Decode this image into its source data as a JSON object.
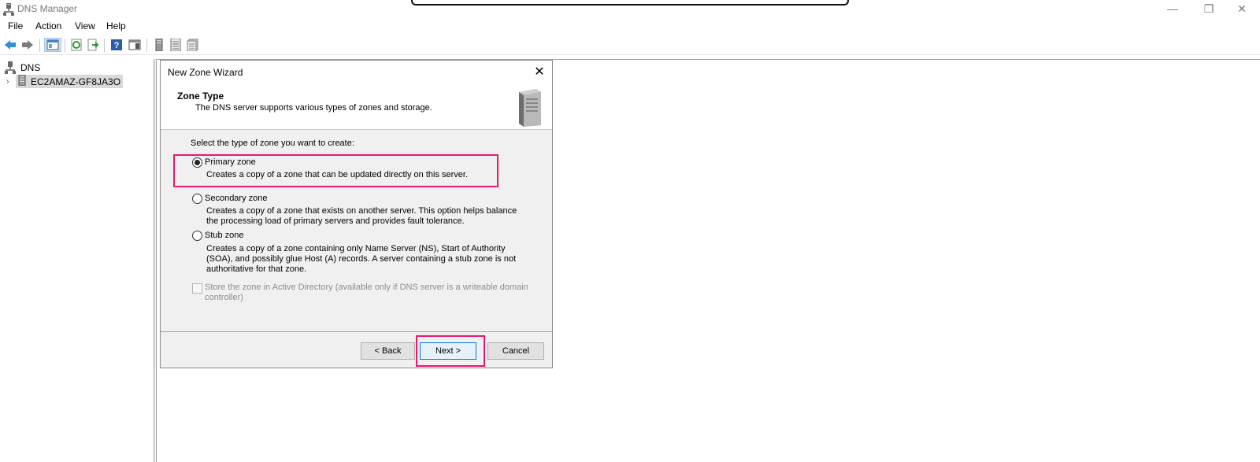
{
  "app": {
    "title": "DNS Manager"
  },
  "window_controls": {
    "minimize": "—",
    "restore": "❐",
    "close": "✕"
  },
  "menu": [
    "File",
    "Action",
    "View",
    "Help"
  ],
  "tree": {
    "root": "DNS",
    "server": "EC2AMAZ-GF8JA3O"
  },
  "dialog": {
    "title": "New Zone Wizard",
    "header_title": "Zone Type",
    "header_subtitle": "The DNS server supports various types of zones and storage.",
    "prompt": "Select the type of zone you want to create:",
    "options": [
      {
        "label": "Primary zone",
        "description": "Creates a copy of a zone that can be updated directly on this server.",
        "selected": true
      },
      {
        "label": "Secondary zone",
        "description_lines": [
          "Creates a copy of a zone that exists on another server. This option helps balance",
          "the processing load of primary servers and provides fault tolerance."
        ],
        "selected": false
      },
      {
        "label": "Stub zone",
        "description_lines": [
          "Creates a copy of a zone containing only Name Server (NS), Start of Authority",
          "(SOA), and possibly glue Host (A) records. A server containing a stub zone is not",
          "authoritative for that zone."
        ],
        "selected": false
      }
    ],
    "ad_store": {
      "lines": [
        "Store the zone in Active Directory (available only if DNS server is a writeable domain",
        "controller)"
      ],
      "checked": false,
      "enabled": false
    },
    "buttons": {
      "back": "< Back",
      "next": "Next >",
      "cancel": "Cancel"
    }
  },
  "colors": {
    "highlight": "#e6196f",
    "default_button_border": "#0078d7"
  }
}
